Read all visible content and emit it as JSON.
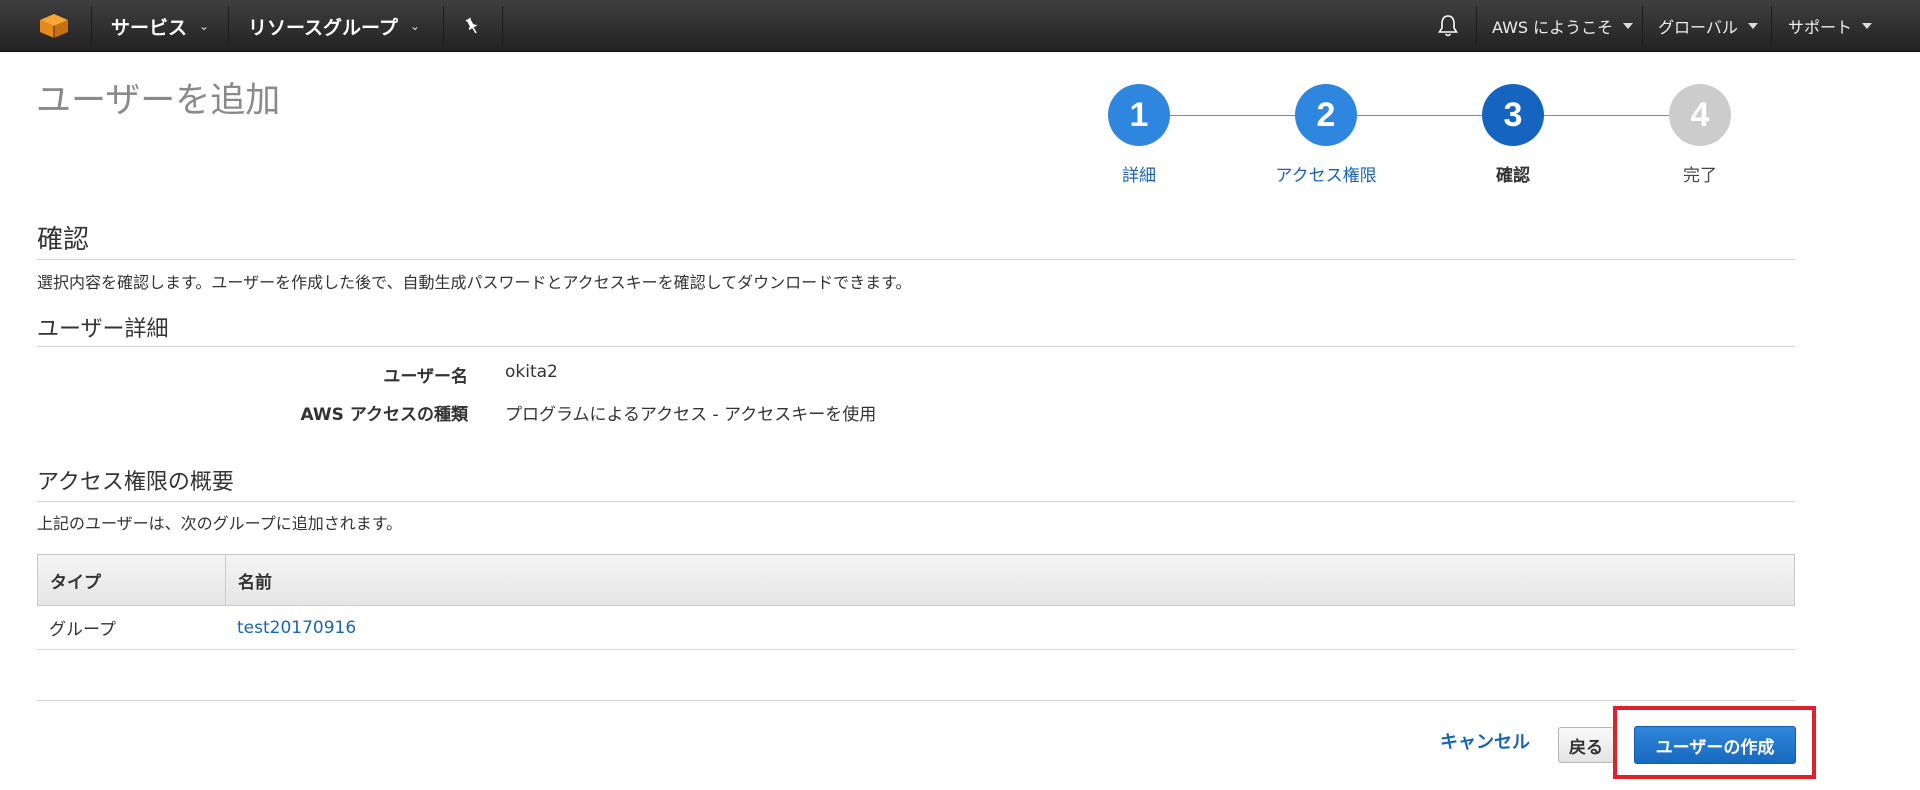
{
  "nav": {
    "services": "サービス",
    "resource_groups": "リソースグループ",
    "welcome": "AWS にようこそ",
    "region": "グローバル",
    "support": "サポート",
    "icons": [
      "aws-cube-icon",
      "pin-icon",
      "bell-icon"
    ]
  },
  "page": {
    "title": "ユーザーを追加"
  },
  "stepper": {
    "steps": [
      {
        "number": "1",
        "label": "詳細",
        "state": "done"
      },
      {
        "number": "2",
        "label": "アクセス権限",
        "state": "done"
      },
      {
        "number": "3",
        "label": "確認",
        "state": "current"
      },
      {
        "number": "4",
        "label": "完了",
        "state": "pending"
      }
    ],
    "colors": {
      "done": "#2e86de",
      "current": "#1565c0",
      "pending": "#cccccc"
    }
  },
  "review": {
    "heading": "確認",
    "description": "選択内容を確認します。ユーザーを作成した後で、自動生成パスワードとアクセスキーを確認してダウンロードできます。"
  },
  "user_details": {
    "heading": "ユーザー詳細",
    "fields": [
      {
        "label": "ユーザー名",
        "value": "okita2"
      },
      {
        "label": "AWS アクセスの種類",
        "value": "プログラムによるアクセス - アクセスキーを使用"
      }
    ]
  },
  "permissions": {
    "heading": "アクセス権限の概要",
    "description": "上記のユーザーは、次のグループに追加されます。",
    "columns": [
      "タイプ",
      "名前"
    ],
    "rows": [
      {
        "type": "グループ",
        "name": "test20170916"
      }
    ]
  },
  "footer": {
    "cancel": "キャンセル",
    "back": "戻る",
    "create": "ユーザーの作成",
    "highlight_color": "#e0202b"
  }
}
